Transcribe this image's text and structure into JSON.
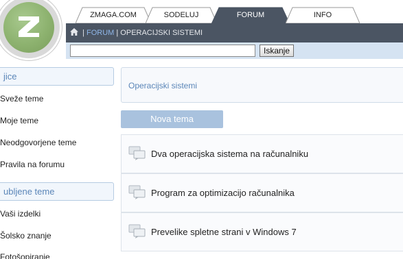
{
  "tabs": [
    {
      "label": "ZMAGA.COM"
    },
    {
      "label": "SODELUJ"
    },
    {
      "label": "FORUM"
    },
    {
      "label": "INFO"
    }
  ],
  "breadcrumb": {
    "separator": "|",
    "forum": "FORUM",
    "current": "OPERACIJSKI SISTEMI"
  },
  "search": {
    "value": "",
    "button_label": "Iskanje"
  },
  "sidebar": {
    "section1_title": "jice",
    "section1_items": [
      "Sveže teme",
      "Moje teme",
      "Neodgovorjene teme",
      "Pravila na forumu"
    ],
    "section2_title": "ubljene teme",
    "section2_items": [
      "Vaši izdelki",
      "Šolsko znanje",
      "Fotošopiranje"
    ]
  },
  "main": {
    "header": "Operacijski sistemi",
    "new_topic_label": "Nova tema",
    "topics": [
      "Dva operacijska sistema na računalniku",
      "Program za optimizacijo računalnika",
      "Prevelike spletne strani v Windows 7"
    ]
  },
  "colors": {
    "navbar": "#4b5563",
    "search_bar": "#d5e3f2",
    "accent": "#5b86b8",
    "button": "#a9c2de",
    "logo_green": "#8db26f"
  },
  "icons": {
    "home": "home-icon",
    "topic": "chat-bubbles-icon",
    "logo": "z-logo"
  }
}
